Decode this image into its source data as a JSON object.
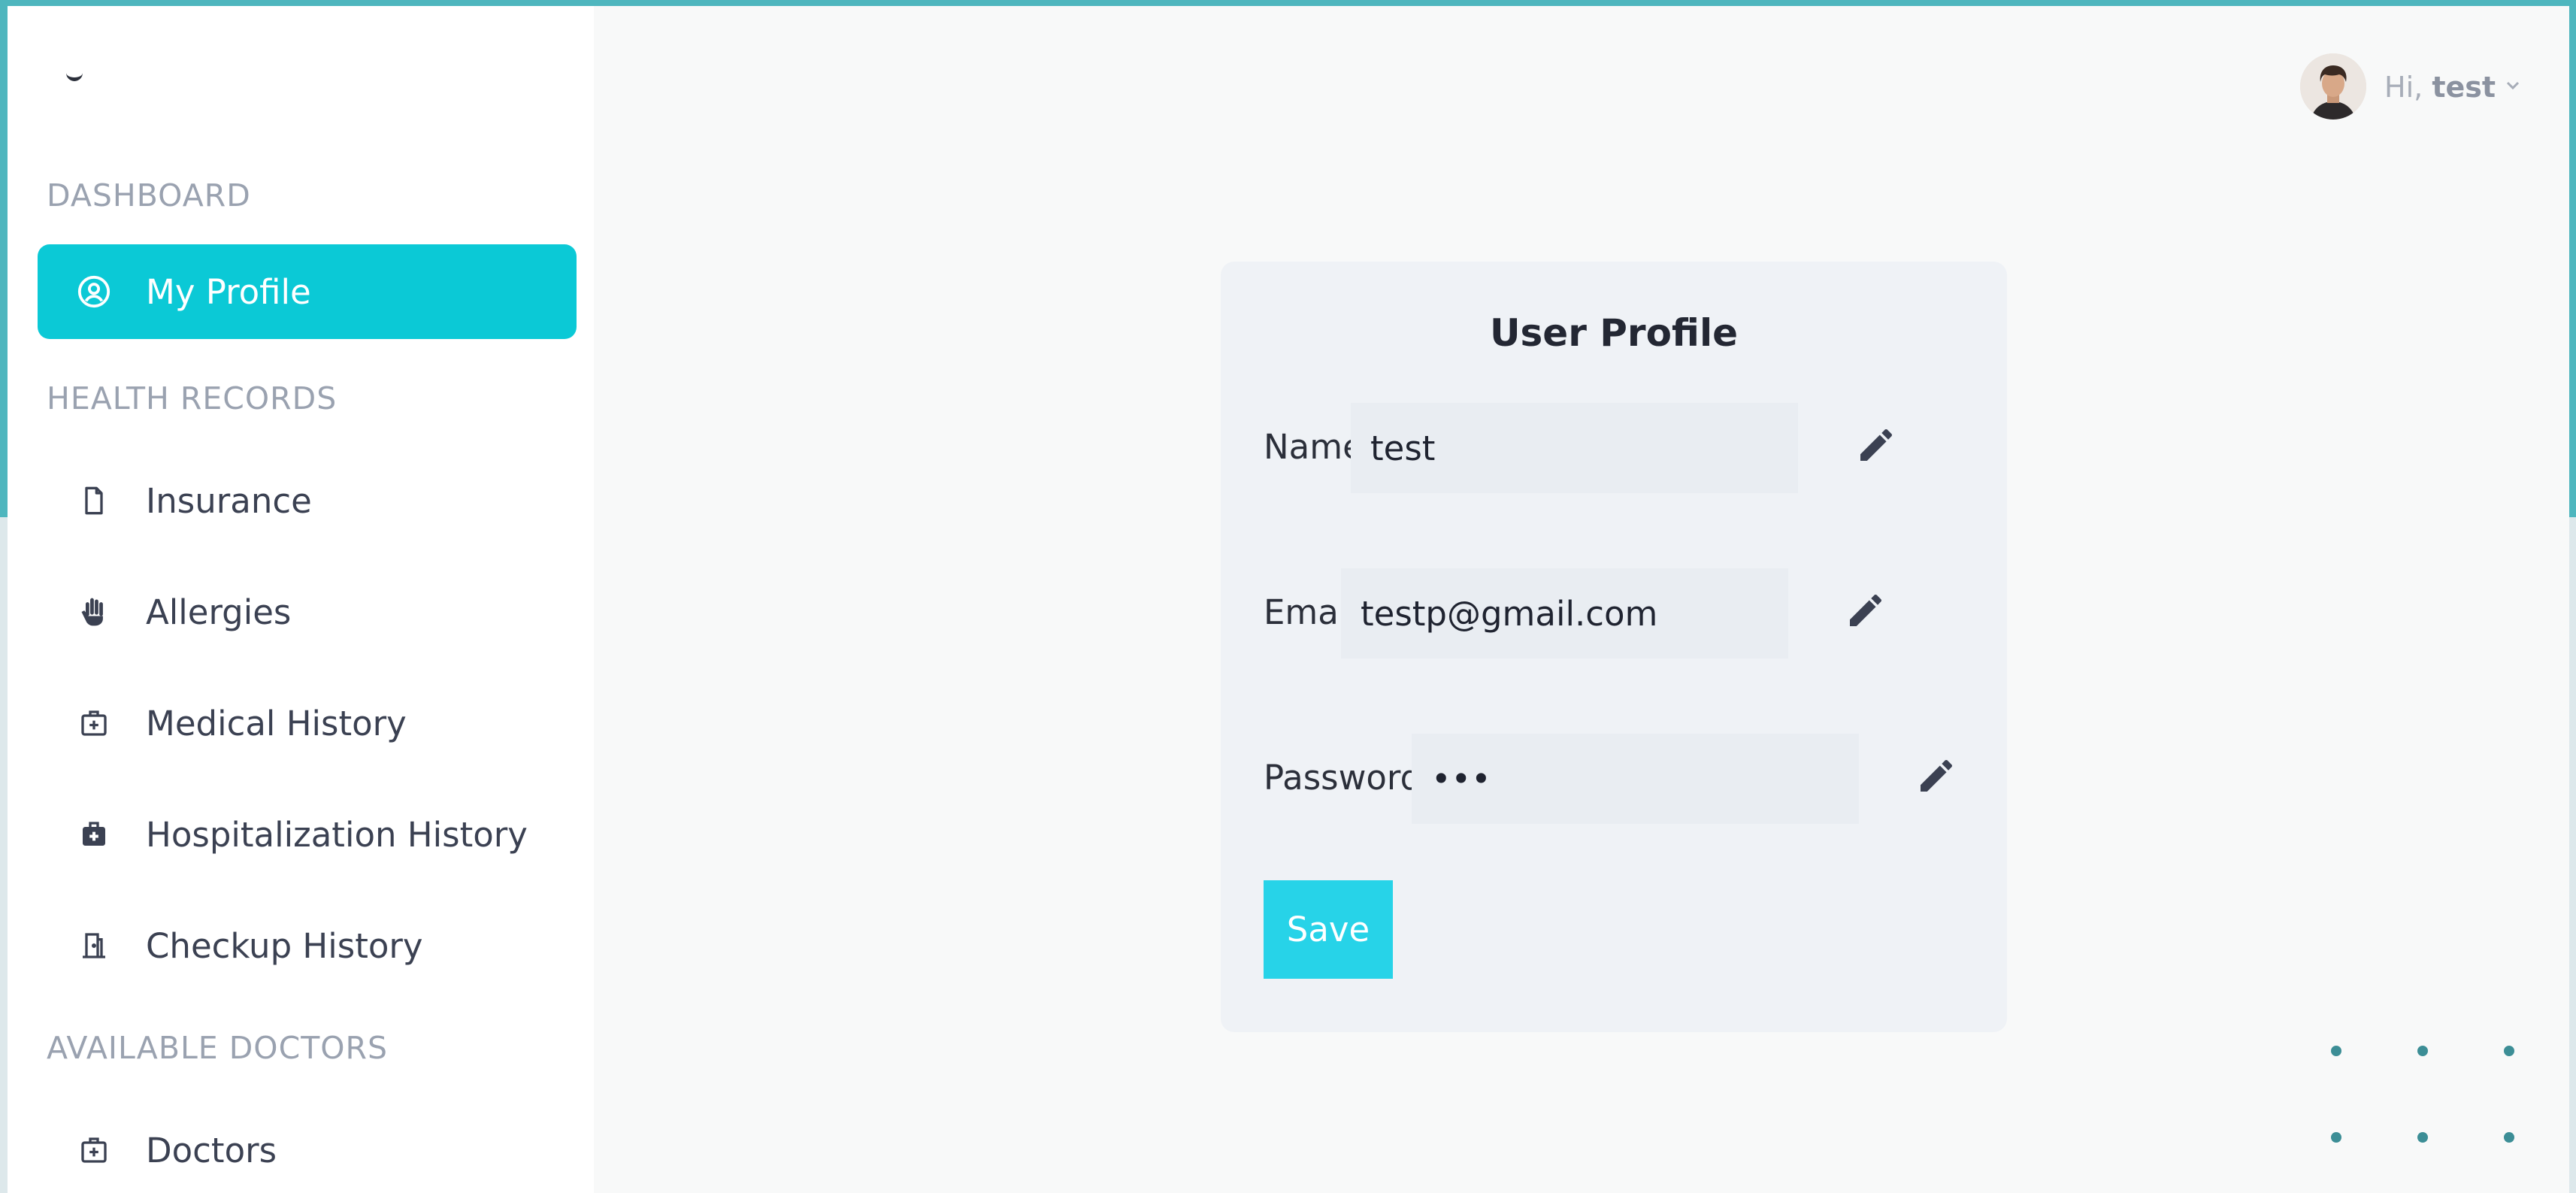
{
  "sidebar": {
    "sections": {
      "dashboard": "DASHBOARD",
      "health_records": "HEALTH RECORDS",
      "available_doctors": "AVAILABLE DOCTORS"
    },
    "items": {
      "my_profile": "My Profile",
      "insurance": "Insurance",
      "allergies": "Allergies",
      "medical_history": "Medical History",
      "hospitalization_history": "Hospitalization History",
      "checkup_history": "Checkup History",
      "doctors": "Doctors"
    }
  },
  "header": {
    "greeting": "Hi,",
    "username": "test"
  },
  "profile": {
    "title": "User Profile",
    "name_label": "Name:",
    "name_value": "test",
    "email_label": "Email:",
    "email_value": "testp@gmail.com",
    "password_label": "Password:",
    "password_value": "•••",
    "save_label": "Save"
  },
  "colors": {
    "accent": "#0bc9d6",
    "save_button": "#27d3e8",
    "frame": "#4eb6be"
  }
}
